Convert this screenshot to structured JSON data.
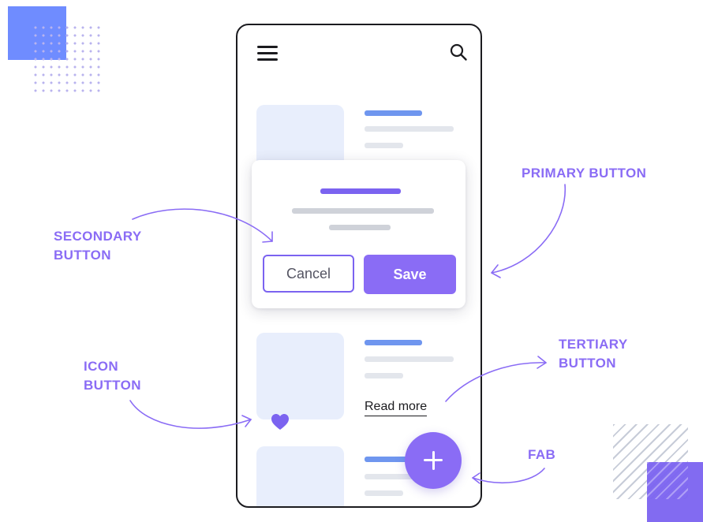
{
  "annotations": {
    "primary_button": "PRIMARY BUTTON",
    "secondary_button_line1": "SECONDARY",
    "secondary_button_line2": "BUTTON",
    "icon_button_line1": "ICON",
    "icon_button_line2": "BUTTON",
    "tertiary_button_line1": "TERTIARY",
    "tertiary_button_line2": "BUTTON",
    "fab": "FAB"
  },
  "dialog": {
    "cancel_label": "Cancel",
    "save_label": "Save"
  },
  "card": {
    "read_more_label": "Read more"
  },
  "icons": {
    "menu": "hamburger-menu-icon",
    "search": "search-icon",
    "heart": "heart-icon",
    "fab": "plus-icon"
  },
  "colors": {
    "accent_purple": "#8a6cf5",
    "blue_bar": "#6f96ef",
    "thumbnail_bg": "#e8eefc",
    "outline": "#1b1b1f"
  }
}
